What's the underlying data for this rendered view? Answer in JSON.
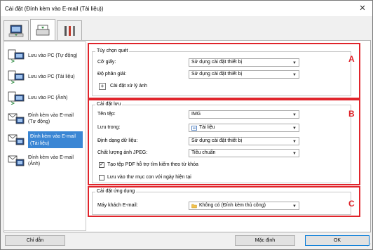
{
  "window": {
    "title": "Cài đặt (Đính kèm vào E-mail (Tài liệu))",
    "close_label": "✕"
  },
  "tabs": [
    {
      "icon": "scan-to-pc-icon"
    },
    {
      "icon": "scanner-icon"
    },
    {
      "icon": "tools-icon"
    }
  ],
  "sidebar": {
    "items": [
      {
        "label": "Lưu vào PC (Tự động)",
        "icon": "save-to-pc-icon",
        "selected": false
      },
      {
        "label": "Lưu vào PC (Tài liệu)",
        "icon": "save-to-pc-icon",
        "selected": false
      },
      {
        "label": "Lưu vào PC (Ảnh)",
        "icon": "save-to-pc-icon",
        "selected": false
      },
      {
        "label": "Đính kèm vào E-mail (Tự động)",
        "icon": "email-attach-icon",
        "selected": false
      },
      {
        "label": "Đính kèm vào E-mail (Tài liệu)",
        "icon": "email-attach-icon",
        "selected": true
      },
      {
        "label": "Đính kèm vào E-mail (Ảnh)",
        "icon": "email-attach-icon",
        "selected": false
      }
    ]
  },
  "scan_options": {
    "title": "Tùy chọn quét",
    "paper_size_label": "Cỡ giấy:",
    "paper_size_value": "Sử dụng cài đặt thiết bị",
    "resolution_label": "Độ phân giải:",
    "resolution_value": "Sử dụng cài đặt thiết bị",
    "image_settings_label": "Cài đặt xử lý ảnh",
    "marker": "A"
  },
  "save_settings": {
    "title": "Cài đặt lưu",
    "filename_label": "Tên tệp:",
    "filename_value": "IMG",
    "save_in_label": "Lưu trong:",
    "save_in_value": "Tài liệu",
    "format_label": "Định dạng dữ liệu:",
    "format_value": "Sử dụng cài đặt thiết bị",
    "jpeg_quality_label": "Chất lượng ảnh JPEG:",
    "jpeg_quality_value": "Tiêu chuẩn",
    "pdf_keyword_label": "Tạo tệp PDF hỗ trợ tìm kiếm theo từ khóa",
    "pdf_keyword_checked": true,
    "subfolder_label": "Lưu vào thư mục con với ngày hiện tại",
    "subfolder_checked": false,
    "marker": "B"
  },
  "app_settings": {
    "title": "Cài đặt ứng dụng",
    "email_client_label": "Máy khách E-mail:",
    "email_client_value": "Không có (Đính kèm thủ công)",
    "marker": "C"
  },
  "footer": {
    "guide_label": "Chỉ dẫn",
    "defaults_label": "Mặc định",
    "ok_label": "OK"
  },
  "colors": {
    "highlight_border": "#e0242b",
    "selection": "#3a86d4"
  }
}
